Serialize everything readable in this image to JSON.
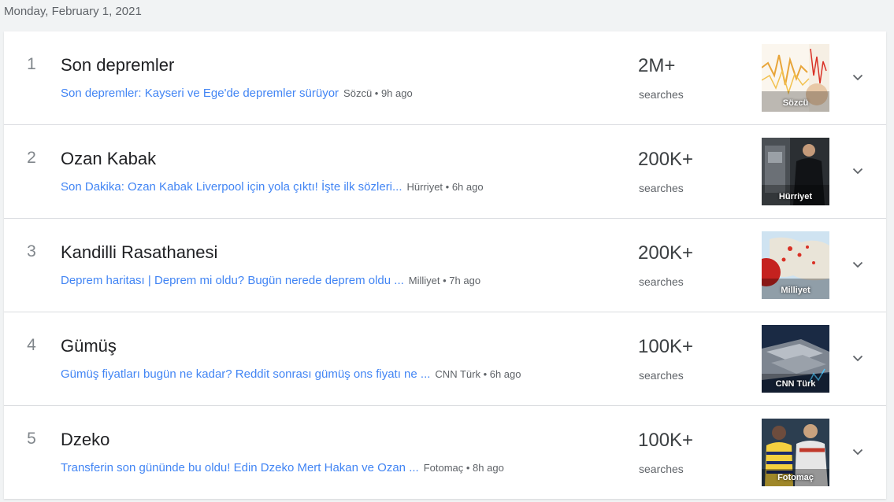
{
  "date_header": "Monday, February 1, 2021",
  "count_suffix_label": "searches",
  "colors": {
    "link": "#4285f4",
    "title": "#202124",
    "muted": "#5f6368",
    "divider": "#dadce0"
  },
  "items": [
    {
      "rank": "1",
      "title": "Son depremler",
      "article": "Son depremler: Kayseri ve Ege'de depremler sürüyor",
      "meta": "Sözcü • 9h ago",
      "count": "2M+",
      "count_label": "searches",
      "thumb_source": "Sözcü",
      "thumb_icon": "seismograph-image"
    },
    {
      "rank": "2",
      "title": "Ozan Kabak",
      "article": "Son Dakika: Ozan Kabak Liverpool için yola çıktı! İşte ilk sözleri...",
      "meta": "Hürriyet • 6h ago",
      "count": "200K+",
      "count_label": "searches",
      "thumb_source": "Hürriyet",
      "thumb_icon": "person-plane-image"
    },
    {
      "rank": "3",
      "title": "Kandilli Rasathanesi",
      "article": "Deprem haritası | Deprem mi oldu? Bugün nerede deprem oldu ...",
      "meta": "Milliyet • 7h ago",
      "count": "200K+",
      "count_label": "searches",
      "thumb_source": "Milliyet",
      "thumb_icon": "earthquake-map-image"
    },
    {
      "rank": "4",
      "title": "Gümüş",
      "article": "Gümüş fiyatları bugün ne kadar? Reddit sonrası gümüş ons fiyatı ne ...",
      "meta": "CNN Türk • 6h ago",
      "count": "100K+",
      "count_label": "searches",
      "thumb_source": "CNN Türk",
      "thumb_icon": "silver-bars-image"
    },
    {
      "rank": "5",
      "title": "Dzeko",
      "article": "Transferin son gününde bu oldu! Edin Dzeko Mert Hakan ve Ozan ...",
      "meta": "Fotomaç • 8h ago",
      "count": "100K+",
      "count_label": "searches",
      "thumb_source": "Fotomaç",
      "thumb_icon": "football-players-image"
    }
  ]
}
